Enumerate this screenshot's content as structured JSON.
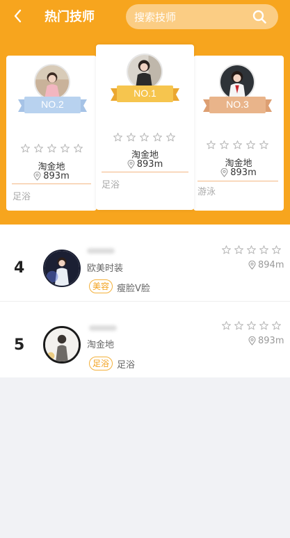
{
  "header": {
    "title": "热门技师",
    "search_placeholder": "搜索技师"
  },
  "top3": [
    {
      "rank_label": "NO.2",
      "location": "淘金地",
      "distance": "893m",
      "service": "足浴",
      "rating": 0,
      "ribbon_color": "#b8d2ef"
    },
    {
      "rank_label": "NO.1",
      "location": "淘金地",
      "distance": "893m",
      "service": "足浴",
      "rating": 0,
      "ribbon_color": "#f6c54e"
    },
    {
      "rank_label": "NO.3",
      "location": "淘金地",
      "distance": "893m",
      "service": "游泳",
      "rating": 0,
      "ribbon_color": "#e9b48a"
    }
  ],
  "list": [
    {
      "rank": "4",
      "location": "欧美时装",
      "tag": "美容",
      "desc": "瘦脸V脸",
      "distance": "894m",
      "rating": 0
    },
    {
      "rank": "5",
      "location": "淘金地",
      "tag": "足浴",
      "desc": "足浴",
      "distance": "893m",
      "rating": 0
    }
  ],
  "colors": {
    "brand": "#f7a51e",
    "tag": "#f3a21e"
  }
}
